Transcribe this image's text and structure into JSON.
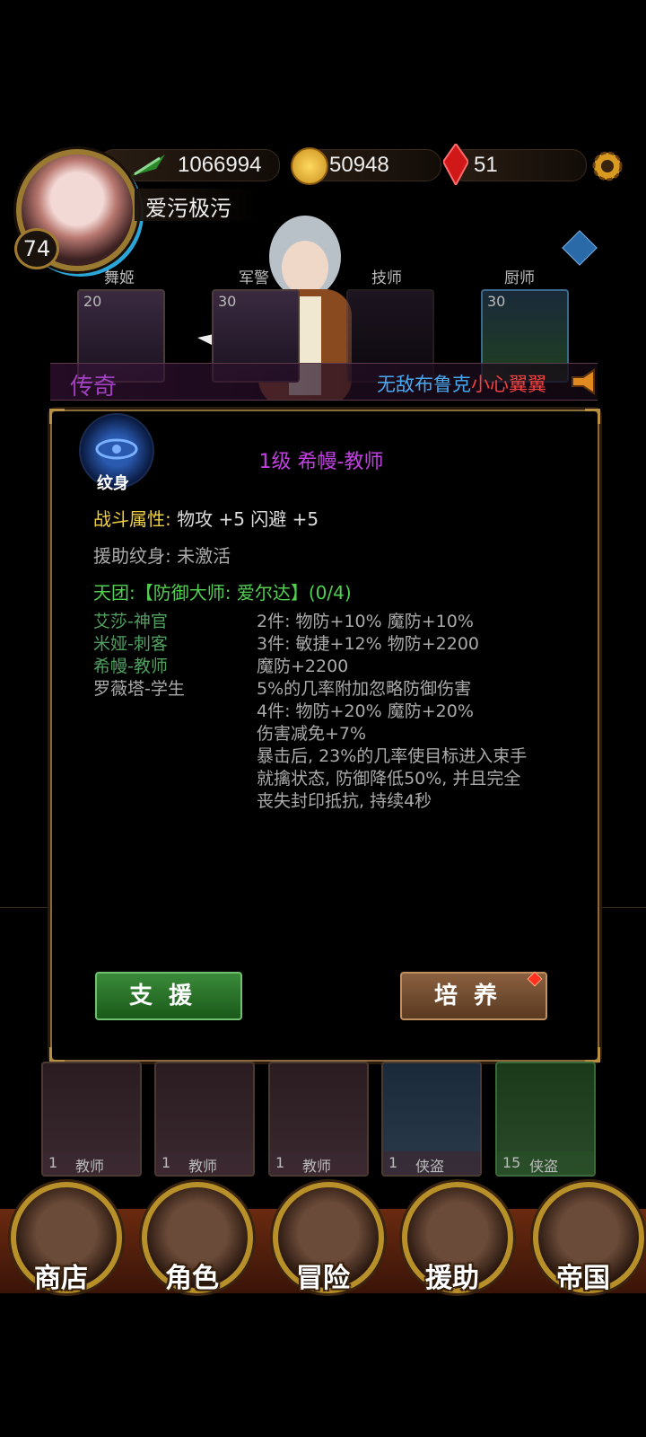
{
  "header": {
    "power": "1066994",
    "gold": "50948",
    "gems": "51",
    "player_name": "爱污极污",
    "player_level": "74"
  },
  "slots": [
    {
      "label": "舞姬",
      "level": "20"
    },
    {
      "label": "军警",
      "level": "30"
    },
    {
      "label": "技师",
      "level": ""
    },
    {
      "label": "厨师",
      "level": "30"
    }
  ],
  "banner": {
    "rarity": "传奇",
    "announcement_name": "无敌布鲁克",
    "announcement_text": "小心翼翼"
  },
  "dialog": {
    "icon_label": "纹身",
    "title": "1级 希幔-教师",
    "combat_label": "战斗属性:",
    "combat_value": "物攻 +5   闪避 +5",
    "assist_tattoo": "援助纹身: 未激活",
    "team_title": "天团:【防御大师: 爱尔达】(0/4)",
    "members": [
      "艾莎-神官",
      "米娅-刺客",
      "希幔-教师",
      "罗薇塔-学生"
    ],
    "bonuses": [
      "2件: 物防+10% 魔防+10%",
      "3件: 敏捷+12% 物防+2200",
      "魔防+2200",
      "5%的几率附加忽略防御伤害",
      "4件: 物防+20% 魔防+20%",
      "伤害减免+7%",
      "暴击后, 23%的几率使目标进入束手",
      "就擒状态, 防御降低50%, 并且完全",
      "丧失封印抵抗, 持续4秒"
    ],
    "support_button": "支援",
    "train_button": "培养"
  },
  "cards": [
    {
      "level": "1",
      "class": "教师"
    },
    {
      "level": "1",
      "class": "教师"
    },
    {
      "level": "1",
      "class": "教师"
    },
    {
      "level": "1",
      "class": "侠盗"
    },
    {
      "level": "15",
      "class": "侠盗"
    }
  ],
  "nav": {
    "shop": "商店",
    "character": "角色",
    "adventure": "冒险",
    "assist": "援助",
    "empire": "帝国"
  },
  "colors": {
    "title_purple": "#c040e0",
    "combat_gold": "#f0d040",
    "team_green": "#50d050",
    "member_green": "#50a060",
    "rarity_purple": "#a040c0"
  }
}
